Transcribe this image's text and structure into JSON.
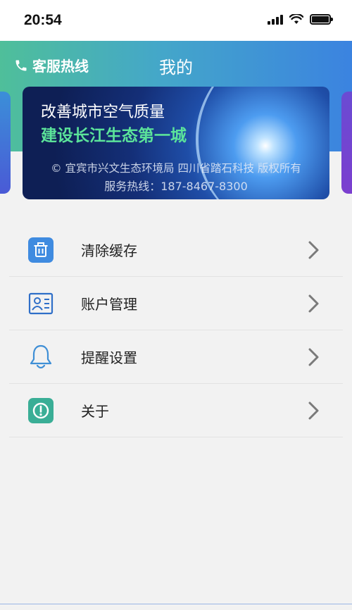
{
  "status_bar": {
    "time": "20:54"
  },
  "header": {
    "hotline_label": "客服热线",
    "title": "我的"
  },
  "banner": {
    "line1": "改善城市空气质量",
    "line2": "建设长江生态第一城",
    "copyright": "© 宜宾市兴文生态环境局 四川省踏石科技 版权所有",
    "phone": "服务热线：187-8467-8300"
  },
  "menu": {
    "items": [
      {
        "label": "清除缓存",
        "icon": "trash-icon"
      },
      {
        "label": "账户管理",
        "icon": "id-card-icon"
      },
      {
        "label": "提醒设置",
        "icon": "bell-icon"
      },
      {
        "label": "关于",
        "icon": "info-icon"
      }
    ]
  },
  "colors": {
    "header_start": "#4fbf9a",
    "header_end": "#3b83e0",
    "banner_accent": "#5be39a",
    "icon_blue": "#3f8be0",
    "icon_teal": "#3aae96"
  }
}
